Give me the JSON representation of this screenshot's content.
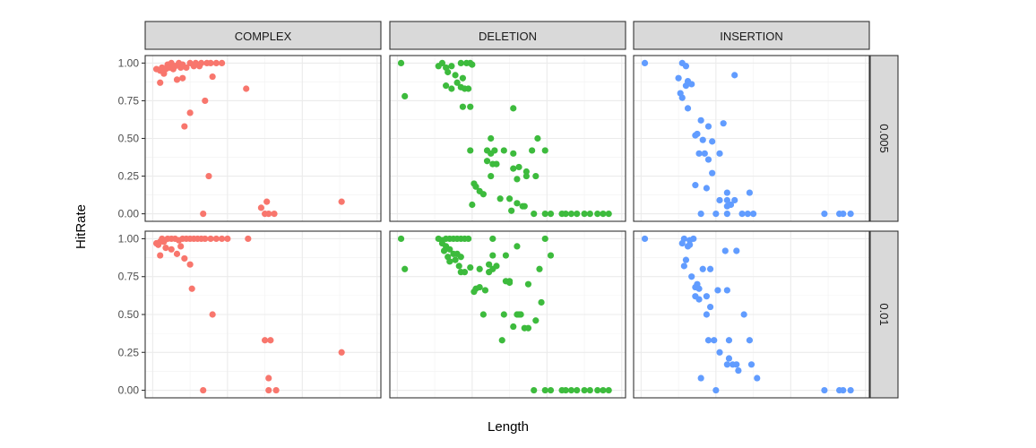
{
  "chart_data": {
    "type": "scatter",
    "title": "",
    "xlabel": "Length",
    "ylabel": "HitRate",
    "xlim": [
      -0.2,
      6.1
    ],
    "ylim": [
      -0.05,
      1.05
    ],
    "yticks": [
      0,
      0.25,
      0.5,
      0.75,
      1
    ],
    "ytick_labels": [
      "0.00",
      "0.25",
      "0.50",
      "0.75",
      "1.00"
    ],
    "xticks_shown": false,
    "grid": true,
    "facet_cols": [
      "COMPLEX",
      "DELETION",
      "INSERTION"
    ],
    "facet_rows": [
      "0.005",
      "0.01"
    ],
    "colors": {
      "COMPLEX": "#f8766d",
      "DELETION": "#3dbb3d",
      "INSERTION": "#619cff"
    },
    "panels": [
      {
        "col": "COMPLEX",
        "row": "0.005",
        "points": [
          [
            0.1,
            0.96
          ],
          [
            0.2,
            0.95
          ],
          [
            0.25,
            0.97
          ],
          [
            0.3,
            0.93
          ],
          [
            0.35,
            0.96
          ],
          [
            0.4,
            0.99
          ],
          [
            0.45,
            0.97
          ],
          [
            0.5,
            1.0
          ],
          [
            0.55,
            0.96
          ],
          [
            0.6,
            0.98
          ],
          [
            0.7,
            1.0
          ],
          [
            0.75,
            0.97
          ],
          [
            0.8,
            0.99
          ],
          [
            0.9,
            0.97
          ],
          [
            1.0,
            1.0
          ],
          [
            1.1,
            0.98
          ],
          [
            1.15,
            1.0
          ],
          [
            1.25,
            0.98
          ],
          [
            1.3,
            1.0
          ],
          [
            1.45,
            1.0
          ],
          [
            1.55,
            1.0
          ],
          [
            1.7,
            1.0
          ],
          [
            1.85,
            1.0
          ],
          [
            0.2,
            0.87
          ],
          [
            0.65,
            0.89
          ],
          [
            0.8,
            0.9
          ],
          [
            1.6,
            0.91
          ],
          [
            2.5,
            0.83
          ],
          [
            1.4,
            0.75
          ],
          [
            1.0,
            0.67
          ],
          [
            0.85,
            0.58
          ],
          [
            1.5,
            0.25
          ],
          [
            1.35,
            0.0
          ],
          [
            2.9,
            0.04
          ],
          [
            3.05,
            0.08
          ],
          [
            3.0,
            0.0
          ],
          [
            3.1,
            0.0
          ],
          [
            3.25,
            0.0
          ],
          [
            5.05,
            0.08
          ]
        ]
      },
      {
        "col": "DELETION",
        "row": "0.005",
        "points": [
          [
            0.1,
            1.0
          ],
          [
            0.2,
            0.78
          ],
          [
            1.1,
            0.98
          ],
          [
            1.2,
            1.0
          ],
          [
            1.3,
            0.97
          ],
          [
            1.35,
            0.94
          ],
          [
            1.45,
            0.98
          ],
          [
            1.55,
            0.92
          ],
          [
            1.6,
            0.87
          ],
          [
            1.7,
            1.0
          ],
          [
            1.75,
            0.9
          ],
          [
            1.85,
            1.0
          ],
          [
            1.95,
            1.0
          ],
          [
            2.0,
            0.99
          ],
          [
            1.3,
            0.85
          ],
          [
            1.45,
            0.83
          ],
          [
            1.7,
            0.84
          ],
          [
            1.8,
            0.83
          ],
          [
            1.9,
            0.83
          ],
          [
            1.75,
            0.71
          ],
          [
            1.95,
            0.71
          ],
          [
            3.1,
            0.7
          ],
          [
            2.5,
            0.5
          ],
          [
            3.75,
            0.5
          ],
          [
            3.95,
            0.42
          ],
          [
            1.95,
            0.42
          ],
          [
            2.4,
            0.42
          ],
          [
            2.5,
            0.4
          ],
          [
            2.6,
            0.42
          ],
          [
            2.85,
            0.42
          ],
          [
            3.1,
            0.4
          ],
          [
            3.6,
            0.42
          ],
          [
            2.4,
            0.35
          ],
          [
            2.55,
            0.33
          ],
          [
            2.65,
            0.33
          ],
          [
            3.1,
            0.3
          ],
          [
            3.25,
            0.31
          ],
          [
            3.45,
            0.28
          ],
          [
            2.5,
            0.25
          ],
          [
            3.2,
            0.23
          ],
          [
            3.45,
            0.25
          ],
          [
            3.7,
            0.25
          ],
          [
            2.05,
            0.2
          ],
          [
            2.1,
            0.18
          ],
          [
            2.2,
            0.15
          ],
          [
            2.3,
            0.13
          ],
          [
            2.75,
            0.1
          ],
          [
            3.0,
            0.1
          ],
          [
            3.2,
            0.07
          ],
          [
            3.35,
            0.05
          ],
          [
            3.4,
            0.05
          ],
          [
            2.0,
            0.06
          ],
          [
            3.05,
            0.02
          ],
          [
            3.65,
            0.0
          ],
          [
            3.95,
            0.0
          ],
          [
            4.1,
            0.0
          ],
          [
            4.4,
            0.0
          ],
          [
            4.5,
            0.0
          ],
          [
            4.65,
            0.0
          ],
          [
            4.8,
            0.0
          ],
          [
            5.0,
            0.0
          ],
          [
            5.15,
            0.0
          ],
          [
            5.35,
            0.0
          ],
          [
            5.5,
            0.0
          ],
          [
            5.65,
            0.0
          ]
        ]
      },
      {
        "col": "INSERTION",
        "row": "0.005",
        "points": [
          [
            0.1,
            1.0
          ],
          [
            1.1,
            1.0
          ],
          [
            1.2,
            0.98
          ],
          [
            1.0,
            0.9
          ],
          [
            1.25,
            0.88
          ],
          [
            1.35,
            0.86
          ],
          [
            1.2,
            0.85
          ],
          [
            2.5,
            0.92
          ],
          [
            1.05,
            0.8
          ],
          [
            1.1,
            0.77
          ],
          [
            1.25,
            0.7
          ],
          [
            1.6,
            0.62
          ],
          [
            1.8,
            0.58
          ],
          [
            2.2,
            0.6
          ],
          [
            1.45,
            0.52
          ],
          [
            1.5,
            0.53
          ],
          [
            1.65,
            0.49
          ],
          [
            1.9,
            0.48
          ],
          [
            1.55,
            0.4
          ],
          [
            1.7,
            0.4
          ],
          [
            2.1,
            0.4
          ],
          [
            1.8,
            0.36
          ],
          [
            1.9,
            0.27
          ],
          [
            1.45,
            0.19
          ],
          [
            1.75,
            0.17
          ],
          [
            2.3,
            0.14
          ],
          [
            2.9,
            0.14
          ],
          [
            2.1,
            0.09
          ],
          [
            2.3,
            0.09
          ],
          [
            2.5,
            0.09
          ],
          [
            2.4,
            0.06
          ],
          [
            2.3,
            0.05
          ],
          [
            1.6,
            0.0
          ],
          [
            2.0,
            0.0
          ],
          [
            2.3,
            0.0
          ],
          [
            2.7,
            0.0
          ],
          [
            2.85,
            0.0
          ],
          [
            3.0,
            0.0
          ],
          [
            4.9,
            0.0
          ],
          [
            5.3,
            0.0
          ],
          [
            5.4,
            0.0
          ],
          [
            5.6,
            0.0
          ]
        ]
      },
      {
        "col": "COMPLEX",
        "row": "0.01",
        "points": [
          [
            0.1,
            0.97
          ],
          [
            0.15,
            0.96
          ],
          [
            0.2,
            0.98
          ],
          [
            0.25,
            1.0
          ],
          [
            0.3,
            0.98
          ],
          [
            0.35,
            0.94
          ],
          [
            0.4,
            1.0
          ],
          [
            0.5,
            1.0
          ],
          [
            0.6,
            1.0
          ],
          [
            0.7,
            0.99
          ],
          [
            0.75,
            0.95
          ],
          [
            0.8,
            1.0
          ],
          [
            0.9,
            1.0
          ],
          [
            1.0,
            1.0
          ],
          [
            1.1,
            1.0
          ],
          [
            1.2,
            1.0
          ],
          [
            1.3,
            1.0
          ],
          [
            1.4,
            1.0
          ],
          [
            1.55,
            1.0
          ],
          [
            1.7,
            1.0
          ],
          [
            1.85,
            1.0
          ],
          [
            2.0,
            1.0
          ],
          [
            2.55,
            1.0
          ],
          [
            0.2,
            0.89
          ],
          [
            0.5,
            0.93
          ],
          [
            0.65,
            0.9
          ],
          [
            0.85,
            0.87
          ],
          [
            1.0,
            0.83
          ],
          [
            1.05,
            0.67
          ],
          [
            1.6,
            0.5
          ],
          [
            1.35,
            0.0
          ],
          [
            3.0,
            0.33
          ],
          [
            3.15,
            0.33
          ],
          [
            3.1,
            0.08
          ],
          [
            3.1,
            0.0
          ],
          [
            3.3,
            0.0
          ],
          [
            5.05,
            0.25
          ]
        ]
      },
      {
        "col": "DELETION",
        "row": "0.01",
        "points": [
          [
            0.1,
            1.0
          ],
          [
            0.2,
            0.8
          ],
          [
            1.1,
            1.0
          ],
          [
            1.2,
            0.99
          ],
          [
            1.3,
            1.0
          ],
          [
            1.4,
            1.0
          ],
          [
            1.5,
            1.0
          ],
          [
            1.6,
            1.0
          ],
          [
            1.7,
            1.0
          ],
          [
            1.8,
            1.0
          ],
          [
            1.9,
            1.0
          ],
          [
            1.2,
            0.97
          ],
          [
            1.3,
            0.95
          ],
          [
            1.4,
            0.93
          ],
          [
            1.5,
            0.9
          ],
          [
            1.6,
            0.9
          ],
          [
            1.7,
            0.88
          ],
          [
            1.25,
            0.92
          ],
          [
            1.35,
            0.88
          ],
          [
            1.4,
            0.85
          ],
          [
            1.55,
            0.86
          ],
          [
            1.65,
            0.82
          ],
          [
            1.7,
            0.78
          ],
          [
            1.8,
            0.78
          ],
          [
            1.95,
            0.81
          ],
          [
            2.2,
            0.8
          ],
          [
            2.45,
            0.83
          ],
          [
            2.55,
            0.8
          ],
          [
            2.65,
            0.82
          ],
          [
            2.9,
            0.72
          ],
          [
            3.0,
            0.71
          ],
          [
            2.45,
            0.78
          ],
          [
            2.55,
            0.89
          ],
          [
            2.9,
            0.89
          ],
          [
            3.2,
            0.95
          ],
          [
            3.95,
            1.0
          ],
          [
            2.55,
            1.0
          ],
          [
            4.1,
            0.89
          ],
          [
            3.8,
            0.8
          ],
          [
            3.5,
            0.7
          ],
          [
            3.0,
            0.72
          ],
          [
            2.1,
            0.67
          ],
          [
            2.2,
            0.68
          ],
          [
            2.05,
            0.65
          ],
          [
            2.35,
            0.66
          ],
          [
            3.85,
            0.58
          ],
          [
            2.3,
            0.5
          ],
          [
            2.85,
            0.5
          ],
          [
            3.2,
            0.5
          ],
          [
            3.25,
            0.5
          ],
          [
            3.3,
            0.5
          ],
          [
            3.7,
            0.46
          ],
          [
            3.1,
            0.42
          ],
          [
            3.4,
            0.41
          ],
          [
            3.5,
            0.41
          ],
          [
            2.8,
            0.33
          ],
          [
            3.65,
            0.0
          ],
          [
            3.95,
            0.0
          ],
          [
            4.1,
            0.0
          ],
          [
            4.4,
            0.0
          ],
          [
            4.5,
            0.0
          ],
          [
            4.65,
            0.0
          ],
          [
            4.8,
            0.0
          ],
          [
            5.0,
            0.0
          ],
          [
            5.15,
            0.0
          ],
          [
            5.35,
            0.0
          ],
          [
            5.5,
            0.0
          ],
          [
            5.65,
            0.0
          ]
        ]
      },
      {
        "col": "INSERTION",
        "row": "0.01",
        "points": [
          [
            0.1,
            1.0
          ],
          [
            1.15,
            1.0
          ],
          [
            1.3,
            0.99
          ],
          [
            1.4,
            1.0
          ],
          [
            1.1,
            0.97
          ],
          [
            1.3,
            0.96
          ],
          [
            1.25,
            0.95
          ],
          [
            2.25,
            0.92
          ],
          [
            2.55,
            0.92
          ],
          [
            1.2,
            0.86
          ],
          [
            1.15,
            0.82
          ],
          [
            1.65,
            0.8
          ],
          [
            1.85,
            0.8
          ],
          [
            1.35,
            0.75
          ],
          [
            1.5,
            0.7
          ],
          [
            1.45,
            0.68
          ],
          [
            1.55,
            0.67
          ],
          [
            2.05,
            0.66
          ],
          [
            2.3,
            0.66
          ],
          [
            1.45,
            0.62
          ],
          [
            1.55,
            0.6
          ],
          [
            1.75,
            0.62
          ],
          [
            1.85,
            0.55
          ],
          [
            1.75,
            0.5
          ],
          [
            2.75,
            0.5
          ],
          [
            1.8,
            0.33
          ],
          [
            1.95,
            0.33
          ],
          [
            2.35,
            0.33
          ],
          [
            2.9,
            0.33
          ],
          [
            2.1,
            0.25
          ],
          [
            2.35,
            0.21
          ],
          [
            2.3,
            0.17
          ],
          [
            2.45,
            0.17
          ],
          [
            2.55,
            0.17
          ],
          [
            2.95,
            0.17
          ],
          [
            2.6,
            0.13
          ],
          [
            1.6,
            0.08
          ],
          [
            3.1,
            0.08
          ],
          [
            2.0,
            0.0
          ],
          [
            4.9,
            0.0
          ],
          [
            5.3,
            0.0
          ],
          [
            5.4,
            0.0
          ],
          [
            5.6,
            0.0
          ]
        ]
      }
    ]
  }
}
